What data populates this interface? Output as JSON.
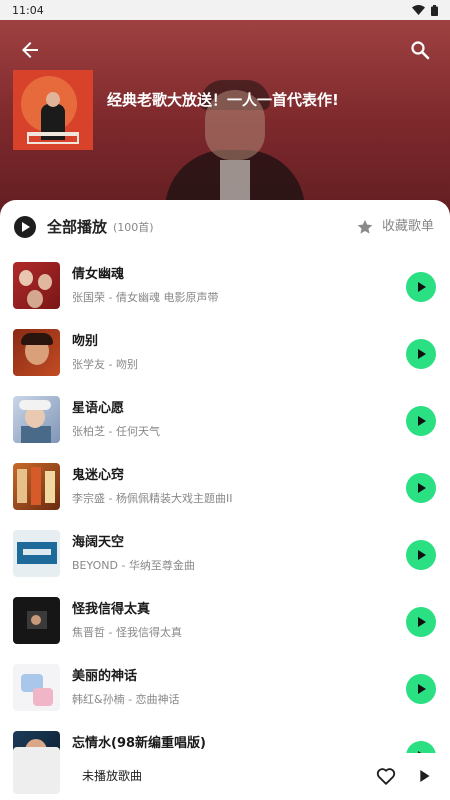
{
  "status": {
    "time": "11:04"
  },
  "header": {
    "title": "经典老歌大放送！一人一首代表作!"
  },
  "play_all": {
    "label": "全部播放",
    "count": "(100首)",
    "collect_label": "收藏歌单"
  },
  "songs": [
    {
      "title": "倩女幽魂",
      "subtitle": "张国荣 - 倩女幽魂 电影原声带"
    },
    {
      "title": "吻别",
      "subtitle": "张学友 - 吻别"
    },
    {
      "title": "星语心愿",
      "subtitle": "张柏芝 - 任何天气"
    },
    {
      "title": "鬼迷心窍",
      "subtitle": "李宗盛 - 杨佩佩精装大戏主题曲II"
    },
    {
      "title": "海阔天空",
      "subtitle": "BEYOND - 华纳至尊金曲"
    },
    {
      "title": "怪我信得太真",
      "subtitle": "焦晋哲 - 怪我信得太真"
    },
    {
      "title": "美丽的神话",
      "subtitle": "韩红&孙楠 - 恋曲神话"
    },
    {
      "title": "忘情水(98新编重唱版)",
      "subtitle": ""
    }
  ],
  "mini_player": {
    "label": "未播放歌曲"
  },
  "colors": {
    "accent_green": "#2bdf83",
    "header_red": "#8f2f33"
  }
}
